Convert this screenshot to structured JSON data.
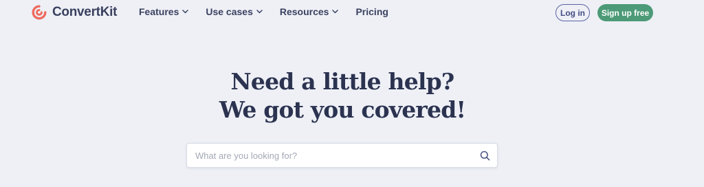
{
  "header": {
    "brand_name": "ConvertKit",
    "nav": [
      {
        "label": "Features",
        "has_dropdown": true
      },
      {
        "label": "Use cases",
        "has_dropdown": true
      },
      {
        "label": "Resources",
        "has_dropdown": true
      },
      {
        "label": "Pricing",
        "has_dropdown": false
      }
    ],
    "login_label": "Log in",
    "signup_label": "Sign up free"
  },
  "hero": {
    "title_line1": "Need a little help?",
    "title_line2": "We got you covered!"
  },
  "search": {
    "placeholder": "What are you looking for?",
    "value": "",
    "icon": "search-icon"
  },
  "colors": {
    "background": "#eef0f6",
    "text_dark": "#2b3350",
    "brand_red": "#ee6a5f",
    "signup_green": "#4c9a77",
    "login_border": "#5b63a3"
  }
}
